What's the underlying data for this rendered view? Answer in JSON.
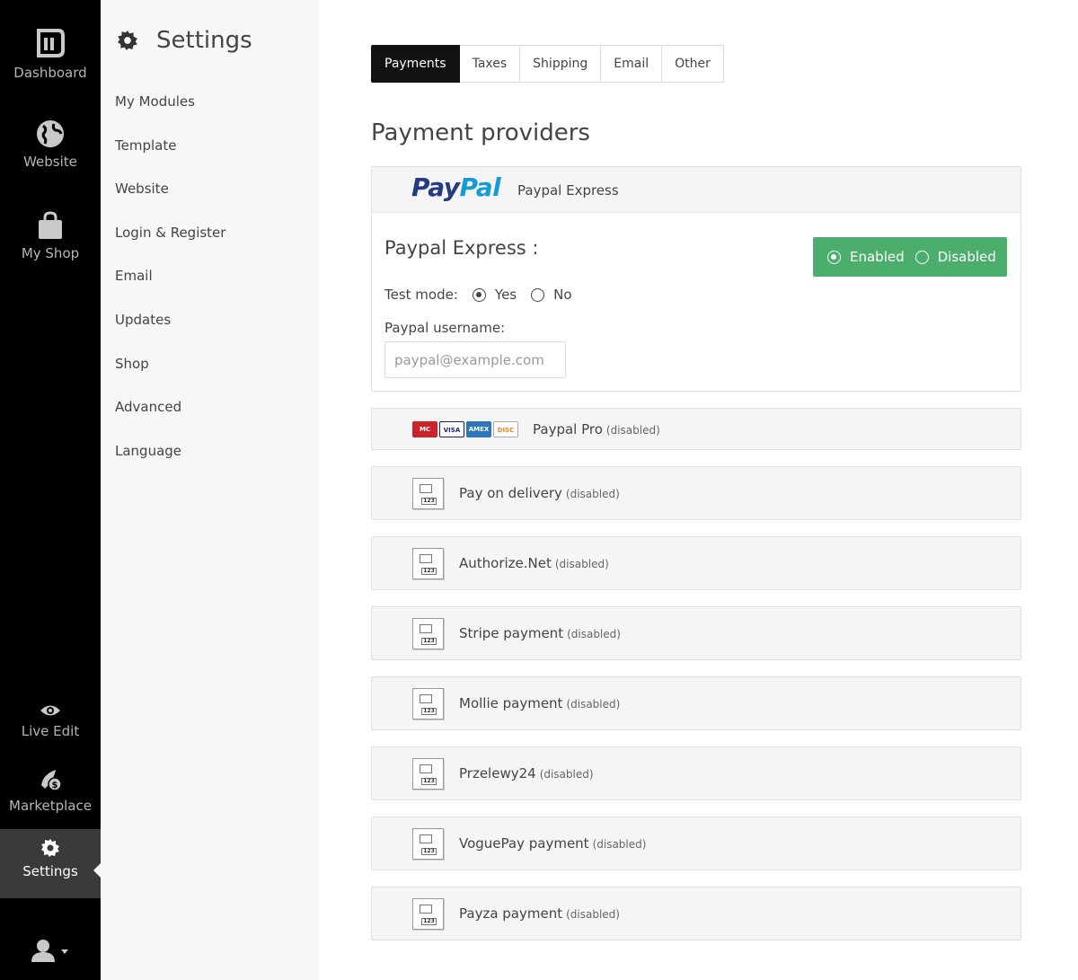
{
  "rail": {
    "dashboard": "Dashboard",
    "website": "Website",
    "myshop": "My Shop",
    "liveedit": "Live Edit",
    "marketplace": "Marketplace",
    "settings": "Settings"
  },
  "subnav": {
    "title": "Settings",
    "items": [
      "My Modules",
      "Template",
      "Website",
      "Login & Register",
      "Email",
      "Updates",
      "Shop",
      "Advanced",
      "Language"
    ]
  },
  "tabs": [
    "Payments",
    "Taxes",
    "Shipping",
    "Email",
    "Other"
  ],
  "section_title": "Payment providers",
  "paypal": {
    "logo_pay": "Pay",
    "logo_pal": "Pal",
    "header_name": "Paypal Express",
    "title": "Paypal Express :",
    "enabled_label": "Enabled",
    "disabled_label": "Disabled",
    "test_mode_label": "Test mode:",
    "yes_label": "Yes",
    "no_label": "No",
    "username_label": "Paypal username:",
    "username_placeholder": "paypal@example.com",
    "username_value": ""
  },
  "providers": [
    {
      "name": "Paypal Pro",
      "tag": "(disabled)"
    },
    {
      "name": "Pay on delivery",
      "tag": "(disabled)"
    },
    {
      "name": "Authorize.Net",
      "tag": "(disabled)"
    },
    {
      "name": "Stripe payment",
      "tag": "(disabled)"
    },
    {
      "name": "Mollie payment",
      "tag": "(disabled)"
    },
    {
      "name": "Przelewy24",
      "tag": "(disabled)"
    },
    {
      "name": "VoguePay payment",
      "tag": "(disabled)"
    },
    {
      "name": "Payza payment",
      "tag": "(disabled)"
    }
  ],
  "cards": {
    "mastercard": "MC",
    "visa": "VISA",
    "amex": "AMEX",
    "discover": "DISC"
  },
  "calc_label": "123",
  "colors": {
    "rail_bg": "#000000",
    "active_tab": "#111111",
    "toggle_green": "#4cae6c",
    "paypal_blue": "#253b80",
    "paypal_light": "#179bd7"
  }
}
